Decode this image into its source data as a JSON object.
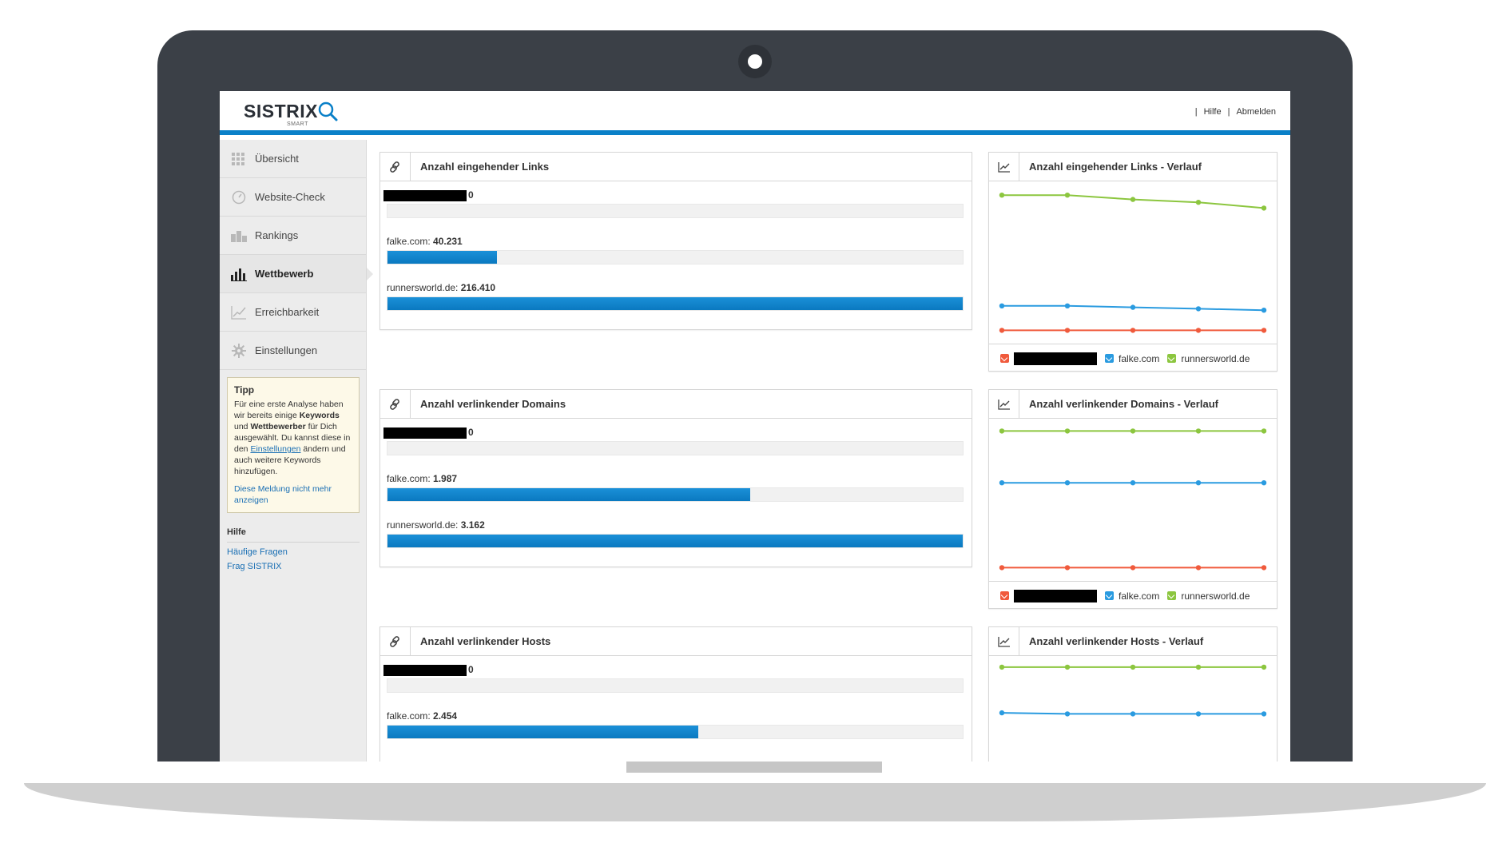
{
  "brand": {
    "name": "SISTRIX",
    "sub": "SMART"
  },
  "top_links": {
    "help": "Hilfe",
    "logout": "Abmelden"
  },
  "sidebar": {
    "items": [
      {
        "label": "Übersicht",
        "icon": "grid-icon"
      },
      {
        "label": "Website-Check",
        "icon": "gauge-icon"
      },
      {
        "label": "Rankings",
        "icon": "rankings-icon"
      },
      {
        "label": "Wettbewerb",
        "icon": "bar-chart-icon",
        "active": true
      },
      {
        "label": "Erreichbarkeit",
        "icon": "line-chart-icon"
      },
      {
        "label": "Einstellungen",
        "icon": "gear-icon"
      }
    ],
    "tip": {
      "title": "Tipp",
      "text1": "Für eine erste Analyse haben wir bereits einige ",
      "kw": "Keywords",
      "text2": " und ",
      "comp": "Wettbewerber",
      "text3": " für Dich ausgewählt. Du kannst diese in den ",
      "settings_link": "Einstellungen",
      "text4": " ändern und auch weitere Keywords hinzufügen.",
      "dismiss": "Diese Meldung nicht mehr anzeigen"
    },
    "help": {
      "title": "Hilfe",
      "links": [
        "Häufige Fragen",
        "Frag SISTRIX"
      ]
    }
  },
  "colors": {
    "accent": "#0a80c8",
    "green": "#8cc63f",
    "blue": "#2a9be0",
    "red": "#f05a3c"
  },
  "panels": [
    {
      "title": "Anzahl eingehender Links",
      "rows": [
        {
          "label": "",
          "value": "0",
          "fraction": 0
        },
        {
          "label": "falke.com: ",
          "value": "40.231",
          "fraction": 0.19
        },
        {
          "label": "runnersworld.de: ",
          "value": "216.410",
          "fraction": 1.0
        }
      ]
    },
    {
      "title": "Anzahl verlinkender Domains",
      "rows": [
        {
          "label": "",
          "value": "0",
          "fraction": 0
        },
        {
          "label": "falke.com: ",
          "value": "1.987",
          "fraction": 0.63
        },
        {
          "label": "runnersworld.de: ",
          "value": "3.162",
          "fraction": 1.0
        }
      ]
    },
    {
      "title": "Anzahl verlinkender Hosts",
      "rows": [
        {
          "label": "",
          "value": "0",
          "fraction": 0
        },
        {
          "label": "falke.com: ",
          "value": "2.454",
          "fraction": 0.54
        }
      ]
    }
  ],
  "chart_panels": [
    {
      "title": "Anzahl eingehender Links - Verlauf",
      "legend": [
        "",
        "falke.com",
        "runnersworld.de"
      ]
    },
    {
      "title": "Anzahl verlinkender Domains - Verlauf",
      "legend": [
        "",
        "falke.com",
        "runnersworld.de"
      ]
    },
    {
      "title": "Anzahl verlinkender Hosts - Verlauf",
      "legend": []
    }
  ],
  "chart_data": [
    {
      "type": "line",
      "title": "Anzahl eingehender Links - Verlauf",
      "x": [
        1,
        2,
        3,
        4,
        5
      ],
      "ylim": [
        0,
        1
      ],
      "series": [
        {
          "name": "runnersworld.de",
          "color": "#8cc63f",
          "values": [
            0.96,
            0.96,
            0.93,
            0.91,
            0.87
          ]
        },
        {
          "name": "falke.com",
          "color": "#2a9be0",
          "values": [
            0.19,
            0.19,
            0.18,
            0.17,
            0.16
          ]
        },
        {
          "name": "",
          "color": "#f05a3c",
          "values": [
            0.02,
            0.02,
            0.02,
            0.02,
            0.02
          ]
        }
      ]
    },
    {
      "type": "line",
      "title": "Anzahl verlinkender Domains - Verlauf",
      "x": [
        1,
        2,
        3,
        4,
        5
      ],
      "ylim": [
        0,
        1
      ],
      "series": [
        {
          "name": "runnersworld.de",
          "color": "#8cc63f",
          "values": [
            0.97,
            0.97,
            0.97,
            0.97,
            0.97
          ]
        },
        {
          "name": "falke.com",
          "color": "#2a9be0",
          "values": [
            0.61,
            0.61,
            0.61,
            0.61,
            0.61
          ]
        },
        {
          "name": "",
          "color": "#f05a3c",
          "values": [
            0.02,
            0.02,
            0.02,
            0.02,
            0.02
          ]
        }
      ]
    },
    {
      "type": "line",
      "title": "Anzahl verlinkender Hosts - Verlauf",
      "x": [
        1,
        2,
        3,
        4,
        5
      ],
      "ylim": [
        0,
        1
      ],
      "series": [
        {
          "name": "runnersworld.de",
          "color": "#8cc63f",
          "values": [
            0.97,
            0.97,
            0.97,
            0.97,
            0.97
          ]
        },
        {
          "name": "falke.com",
          "color": "#2a9be0",
          "values": [
            0.53,
            0.52,
            0.52,
            0.52,
            0.52
          ]
        }
      ]
    }
  ]
}
